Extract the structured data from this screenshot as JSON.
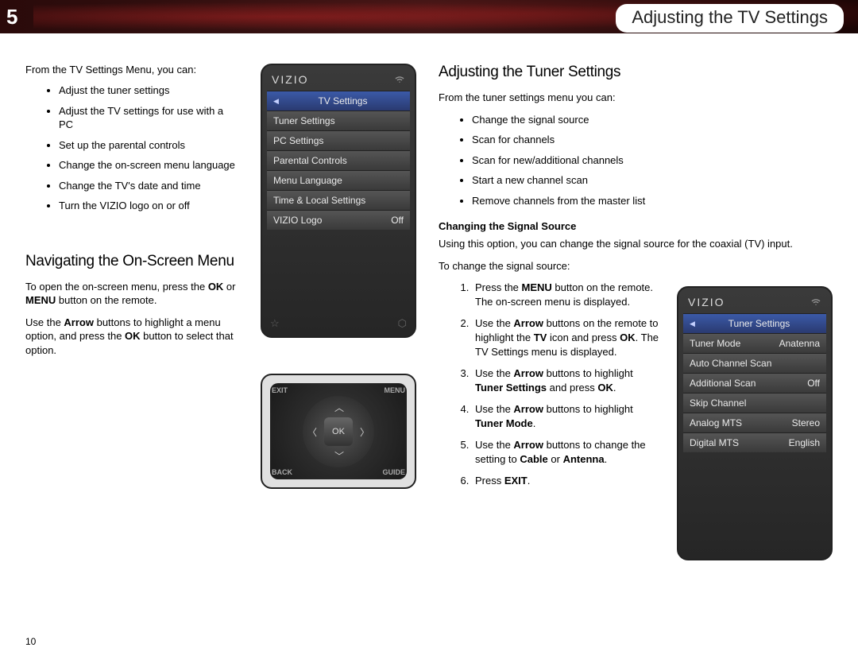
{
  "header": {
    "chapter_number": "5",
    "chapter_title": "Adjusting the TV Settings"
  },
  "left": {
    "intro": "From the TV Settings Menu, you can:",
    "bullets": [
      "Adjust the tuner settings",
      "Adjust the TV settings for use with a PC",
      "Set up the parental controls",
      "Change the on-screen menu language",
      "Change the TV's date and time",
      "Turn the VIZIO logo on or off"
    ],
    "nav_heading": "Navigating the On-Screen Menu",
    "nav_p1a": "To open the on-screen menu, press the ",
    "nav_p1_ok": "OK",
    "nav_p1_or": " or ",
    "nav_p1_menu": "MENU",
    "nav_p1b": " button on the remote.",
    "nav_p2a": "Use the ",
    "nav_p2_arrow": "Arrow",
    "nav_p2b": " buttons to highlight a menu option, and press the ",
    "nav_p2_ok": "OK",
    "nav_p2c": " button to select that option."
  },
  "tv_settings_menu": {
    "brand": "VIZIO",
    "items": [
      {
        "label": "TV Settings",
        "value": "",
        "selected": true
      },
      {
        "label": "Tuner Settings",
        "value": ""
      },
      {
        "label": "PC Settings",
        "value": ""
      },
      {
        "label": "Parental Controls",
        "value": ""
      },
      {
        "label": "Menu Language",
        "value": ""
      },
      {
        "label": "Time & Local Settings",
        "value": ""
      },
      {
        "label": "VIZIO Logo",
        "value": "Off"
      }
    ]
  },
  "remote": {
    "ok": "OK",
    "exit": "EXIT",
    "menu": "MENU",
    "back": "BACK",
    "guide": "GUIDE"
  },
  "right": {
    "heading": "Adjusting the Tuner Settings",
    "intro": "From the tuner settings menu you can:",
    "bullets": [
      "Change the signal source",
      "Scan for channels",
      "Scan for new/additional channels",
      "Start a new channel scan",
      "Remove channels from the master list"
    ],
    "sub_heading": "Changing the Signal Source",
    "sub_desc": "Using this option, you can change the signal source for the coaxial (TV) input.",
    "steps_intro": "To change the signal source:",
    "step1a": "Press the ",
    "step1_menu": "MENU",
    "step1b": " button on the remote. The on-screen menu is displayed.",
    "step2a": "Use the ",
    "step2_arrow": "Arrow",
    "step2b": " buttons on the remote to highlight the ",
    "step2_tv": "TV",
    "step2c": " icon and press ",
    "step2_ok": "OK",
    "step2d": ". The TV Settings menu is displayed.",
    "step3a": "Use the ",
    "step3_arrow": "Arrow",
    "step3b": " buttons to highlight ",
    "step3_ts": "Tuner Settings",
    "step3c": " and press ",
    "step3_ok": "OK",
    "step3d": ".",
    "step4a": "Use the ",
    "step4_arrow": "Arrow",
    "step4b": " buttons to highlight ",
    "step4_tm": "Tuner Mode",
    "step4c": ".",
    "step5a": "Use the ",
    "step5_arrow": "Arrow",
    "step5b": " buttons to change the setting to ",
    "step5_cable": "Cable",
    "step5_or": " or ",
    "step5_antenna": "Antenna",
    "step5c": ".",
    "step6a": "Press ",
    "step6_exit": "EXIT",
    "step6b": "."
  },
  "tuner_menu": {
    "brand": "VIZIO",
    "items": [
      {
        "label": "Tuner Settings",
        "value": "",
        "selected": true
      },
      {
        "label": "Tuner Mode",
        "value": "Anatenna"
      },
      {
        "label": "Auto Channel Scan",
        "value": ""
      },
      {
        "label": "Additional Scan",
        "value": "Off"
      },
      {
        "label": "Skip Channel",
        "value": ""
      },
      {
        "label": "Analog MTS",
        "value": "Stereo"
      },
      {
        "label": "Digital MTS",
        "value": "English"
      }
    ]
  },
  "page_number": "10"
}
